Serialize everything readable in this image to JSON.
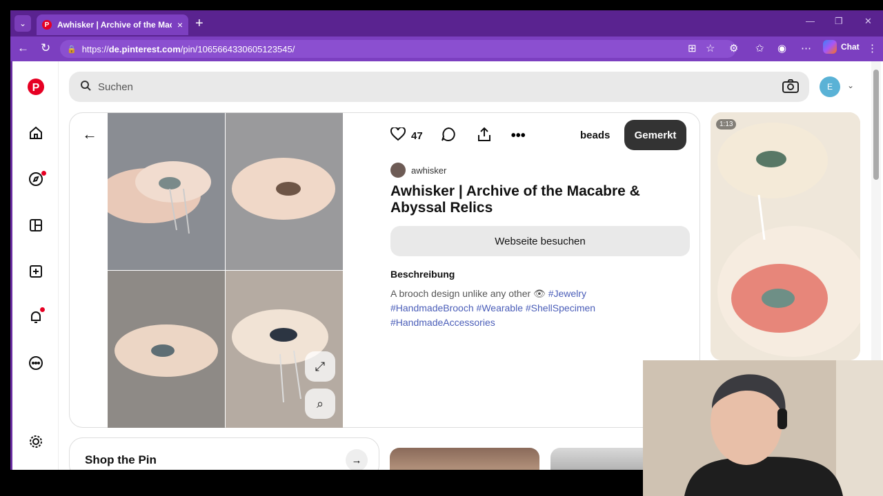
{
  "browser": {
    "tab_title": "Awhisker | Archive of the Macabre",
    "url_prefix": "https://",
    "url_host": "de.pinterest.com",
    "url_path": "/pin/1065664330605123545/",
    "chat_label": "Chat"
  },
  "header": {
    "search_placeholder": "Suchen",
    "avatar_initial": "E"
  },
  "pin": {
    "like_count": "47",
    "board_name": "beads",
    "save_label": "Gemerkt",
    "author": "awhisker",
    "title": "Awhisker | Archive of the Macabre & Abyssal Relics",
    "visit_label": "Webseite besuchen",
    "description_heading": "Beschreibung",
    "description_text": "A brooch design unlike any other 👁",
    "tags": [
      "#Jewelry",
      "#HandmadeBrooch",
      "#Wearable",
      "#ShellSpecimen",
      "#HandmadeAccessories"
    ]
  },
  "related": {
    "video_duration": "1:13"
  },
  "shop": {
    "title": "Shop the Pin"
  },
  "colors": {
    "brand": "#e60023",
    "browser_frame": "#6b2fa3",
    "tag_link": "#4a5db8"
  }
}
